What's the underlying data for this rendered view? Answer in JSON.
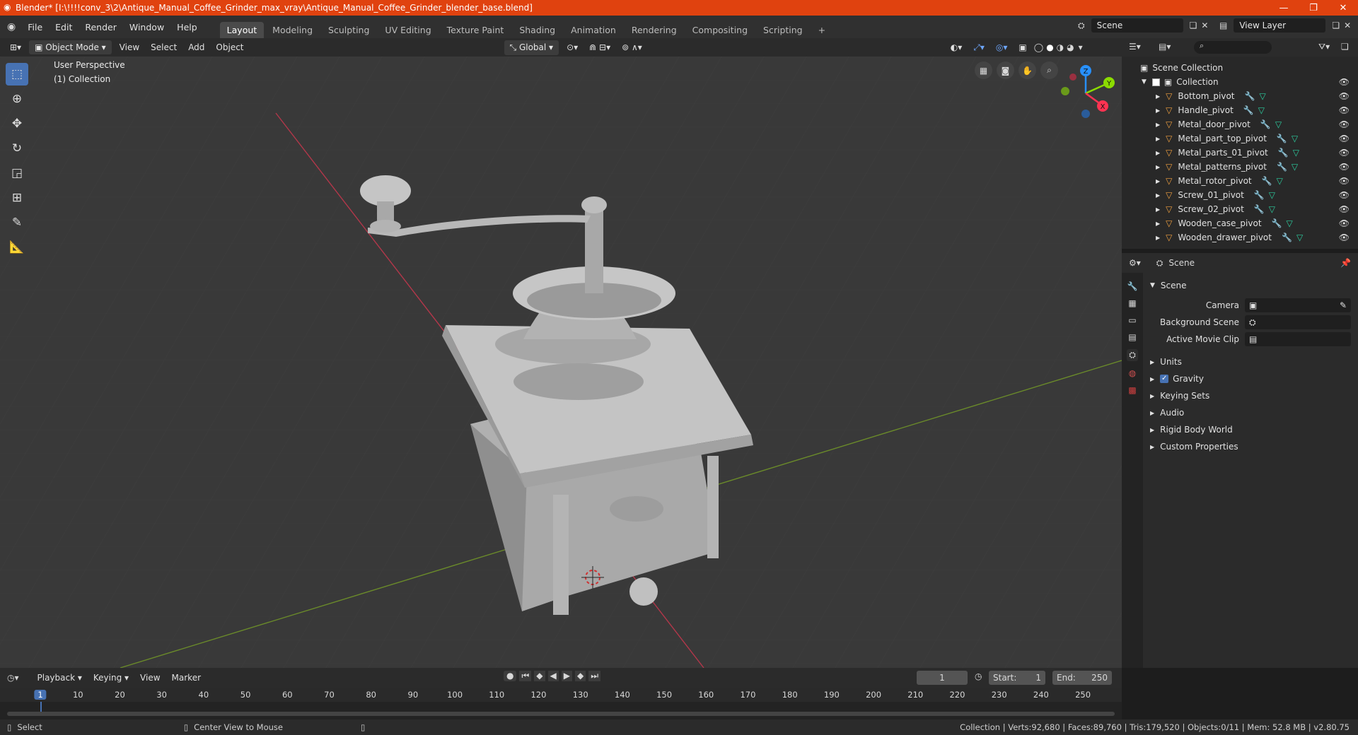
{
  "window": {
    "title": "Blender* [I:\\!!!!conv_3\\2\\Antique_Manual_Coffee_Grinder_max_vray\\Antique_Manual_Coffee_Grinder_blender_base.blend]"
  },
  "menu": {
    "items": [
      "File",
      "Edit",
      "Render",
      "Window",
      "Help"
    ]
  },
  "workspaces": [
    "Layout",
    "Modeling",
    "Sculpting",
    "UV Editing",
    "Texture Paint",
    "Shading",
    "Animation",
    "Rendering",
    "Compositing",
    "Scripting"
  ],
  "active_workspace": "Layout",
  "scene_selector": {
    "value": "Scene"
  },
  "view_layer_selector": {
    "value": "View Layer"
  },
  "viewport_header": {
    "mode": "Object Mode",
    "menus": [
      "View",
      "Select",
      "Add",
      "Object"
    ],
    "transform": "Global"
  },
  "viewport": {
    "perspective": "User Perspective",
    "collection": "(1) Collection"
  },
  "gizmo": {
    "x": "X",
    "y": "Y",
    "z": "Z"
  },
  "outliner": {
    "root": "Scene Collection",
    "collection": "Collection",
    "objects": [
      "Bottom_pivot",
      "Handle_pivot",
      "Metal_door_pivot",
      "Metal_part_top_pivot",
      "Metal_parts_01_pivot",
      "Metal_patterns_pivot",
      "Metal_rotor_pivot",
      "Screw_01_pivot",
      "Screw_02_pivot",
      "Wooden_case_pivot",
      "Wooden_drawer_pivot"
    ]
  },
  "properties": {
    "context": "Scene",
    "panel": "Scene",
    "fields": [
      {
        "label": "Camera"
      },
      {
        "label": "Background Scene"
      },
      {
        "label": "Active Movie Clip"
      }
    ],
    "sections": [
      "Units",
      "Gravity",
      "Keying Sets",
      "Audio",
      "Rigid Body World",
      "Custom Properties"
    ]
  },
  "timeline": {
    "menus": [
      "Playback",
      "Keying",
      "View",
      "Marker"
    ],
    "current_frame": "1",
    "start_label": "Start:",
    "start": "1",
    "end_label": "End:",
    "end": "250",
    "ticks": [
      "1",
      "10",
      "20",
      "30",
      "40",
      "50",
      "60",
      "70",
      "80",
      "90",
      "100",
      "110",
      "120",
      "130",
      "140",
      "150",
      "160",
      "170",
      "180",
      "190",
      "200",
      "210",
      "220",
      "230",
      "240",
      "250"
    ]
  },
  "status": {
    "select": "Select",
    "center": "Center View to Mouse",
    "stats": "Collection | Verts:92,680 | Faces:89,760 | Tris:179,520 | Objects:0/11 | Mem: 52.8 MB | v2.80.75"
  },
  "colors": {
    "accent": "#4772b3",
    "titlebar": "#e0420f",
    "x_axis": "#ff3352",
    "y_axis": "#8bdc00",
    "z_axis": "#2890ff"
  }
}
